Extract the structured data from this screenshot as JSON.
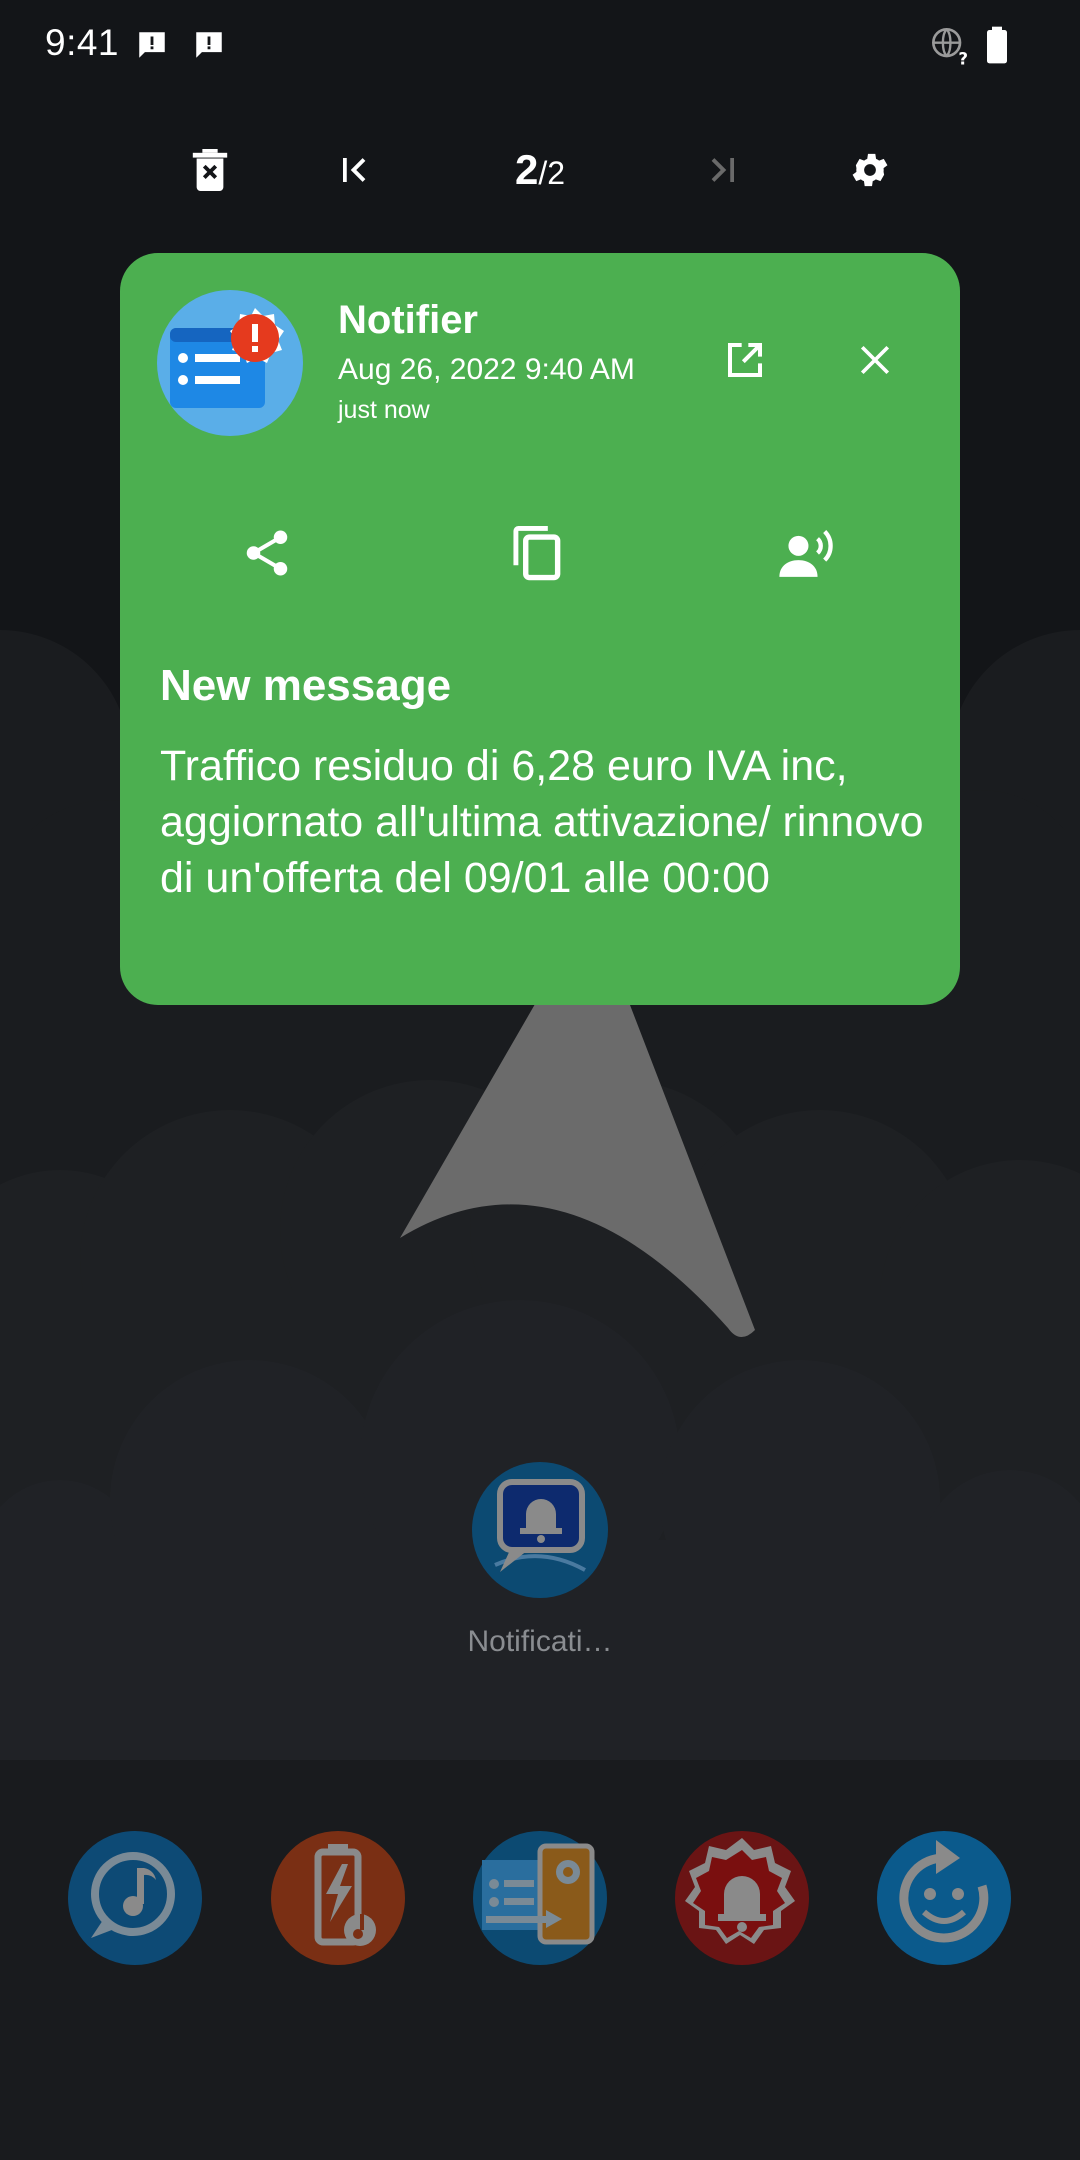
{
  "status_bar": {
    "time": "9:41",
    "icons": [
      "message-alert-icon",
      "message-alert-icon",
      "globe-unknown-icon",
      "battery-icon"
    ]
  },
  "toolbar": {
    "current_page": "2",
    "separator": "/",
    "total_pages": "2",
    "icons": [
      "delete-icon",
      "first-page-icon",
      "last-page-icon",
      "settings-icon"
    ]
  },
  "notification": {
    "app_name": "Notifier",
    "date": "Aug 26, 2022 9:40 AM",
    "relative_time": "just now",
    "title": "New message",
    "body": "Traffico residuo di 6,28 euro IVA inc, aggiornato all'ultima attivazione/ rinnovo di un'offerta del 09/01 alle 00:00",
    "card_color": "#4caf50",
    "actions": [
      "open-external-icon",
      "close-icon",
      "share-icon",
      "copy-icon",
      "speak-icon"
    ]
  },
  "home": {
    "app_label": "Notificati…"
  },
  "colors": {
    "background": "#131518",
    "dock_blue": "#0d5a8a",
    "dock_orange": "#8a3a1a",
    "dock_red": "#7a1414"
  }
}
